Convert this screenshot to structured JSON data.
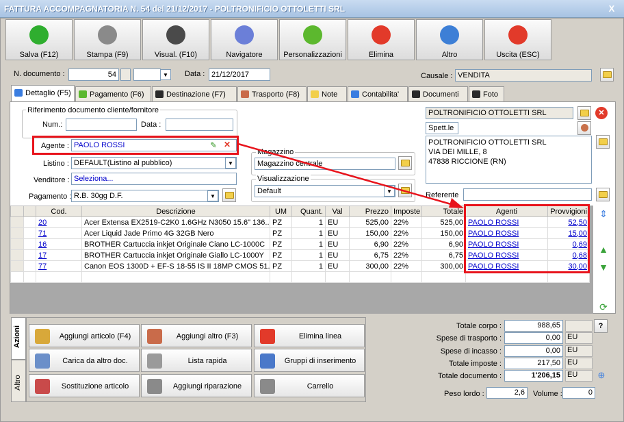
{
  "window": {
    "title": "FATTURA ACCOMPAGNATORIA N. 54 del 21/12/2017 - POLTRONIFICIO OTTOLETTI SRL",
    "close": "X"
  },
  "toolbar": [
    {
      "name": "save",
      "label": "Salva (F12)",
      "icon": "check-icon",
      "color": "#2fae2f"
    },
    {
      "name": "print",
      "label": "Stampa (F9)",
      "icon": "printer-icon",
      "color": "#8a8a8a"
    },
    {
      "name": "preview",
      "label": "Visual. (F10)",
      "icon": "magic-wand-icon",
      "color": "#4a4a4a"
    },
    {
      "name": "navigator",
      "label": "Navigatore",
      "icon": "compass-icon",
      "color": "#6b7fd8"
    },
    {
      "name": "customize",
      "label": "Personalizzazioni",
      "icon": "puzzle-icon",
      "color": "#5cb82e"
    },
    {
      "name": "delete",
      "label": "Elimina",
      "icon": "red-x-icon",
      "color": "#e23a2a"
    },
    {
      "name": "other",
      "label": "Altro",
      "icon": "magnifier-icon",
      "color": "#3d7fd6"
    },
    {
      "name": "exit",
      "label": "Uscita (ESC)",
      "icon": "power-icon",
      "color": "#e23a2a"
    }
  ],
  "header": {
    "doc_label": "N. documento :",
    "doc_number": "54",
    "data_label": "Data :",
    "data_value": "21/12/2017",
    "causale_label": "Causale :",
    "causale_value": "VENDITA"
  },
  "tabs": [
    "Dettaglio (F5)",
    "Pagamento (F6)",
    "Destinazione (F7)",
    "Trasporto (F8)",
    "Note",
    "Contabilita'",
    "Documenti",
    "Foto"
  ],
  "riferimento": {
    "title": "Riferimento documento cliente/fornitore",
    "num_label": "Num.:",
    "data_label": "Data :"
  },
  "fields": {
    "agente_label": "Agente :",
    "agente_value": "PAOLO ROSSI",
    "listino_label": "Listino :",
    "listino_value": "DEFAULT(Listino al pubblico)",
    "venditore_label": "Venditore :",
    "venditore_value": "Seleziona...",
    "pagamento_label": "Pagamento :",
    "pagamento_value": "R.B. 30gg D.F."
  },
  "magazzino": {
    "title": "Magazzino",
    "value": "Magazzino centrale"
  },
  "visualizzazione": {
    "title": "Visualizzazione",
    "value": "Default"
  },
  "customer": {
    "name": "POLTRONIFICIO OTTOLETTI SRL",
    "salutation": "Spett.le",
    "address1": "POLTRONIFICIO OTTOLETTI SRL",
    "address2": "VIA DEI MILLE, 8",
    "address3": "47838 RICCIONE (RN)",
    "referente_label": "Referente"
  },
  "grid": {
    "columns": [
      "Cod.",
      "Descrizione",
      "UM",
      "Quant.",
      "Val",
      "Prezzo",
      "Imposte",
      "Totale",
      "Agenti",
      "Provvigioni"
    ],
    "rows": [
      [
        "20",
        "Acer Extensa EX2519-C2K0 1.6GHz N3050 15.6\" 136...",
        "PZ",
        "1",
        "EU",
        "525,00",
        "22%",
        "525,00",
        "PAOLO ROSSI",
        "52,50"
      ],
      [
        "71",
        "Acer Liquid Jade Primo 4G 32GB Nero",
        "PZ",
        "1",
        "EU",
        "150,00",
        "22%",
        "150,00",
        "PAOLO ROSSI",
        "15,00"
      ],
      [
        "16",
        "BROTHER Cartuccia inkjet Originale Ciano LC-1000C",
        "PZ",
        "1",
        "EU",
        "6,90",
        "22%",
        "6,90",
        "PAOLO ROSSI",
        "0,69"
      ],
      [
        "17",
        "BROTHER Cartuccia inkjet Originale Giallo LC-1000Y",
        "PZ",
        "1",
        "EU",
        "6,75",
        "22%",
        "6,75",
        "PAOLO ROSSI",
        "0,68"
      ],
      [
        "77",
        "Canon EOS 1300D + EF-S 18-55 IS II 18MP CMOS 51...",
        "PZ",
        "1",
        "EU",
        "300,00",
        "22%",
        "300,00",
        "PAOLO ROSSI",
        "30,00"
      ]
    ]
  },
  "side_tabs": {
    "actions": "Azioni",
    "other": "Altro"
  },
  "actions": [
    {
      "name": "aggiungi-articolo",
      "label": "Aggiungi articolo (F4)",
      "icon": "box-add-icon",
      "color": "#d8a83a"
    },
    {
      "name": "aggiungi-altro",
      "label": "Aggiungi altro (F3)",
      "icon": "grid-add-icon",
      "color": "#c96b4a"
    },
    {
      "name": "elimina-linea",
      "label": "Elimina linea",
      "icon": "red-x-icon",
      "color": "#e23a2a"
    },
    {
      "name": "carica-altro-doc",
      "label": "Carica da altro doc.",
      "icon": "checklist-icon",
      "color": "#6b8fc9"
    },
    {
      "name": "lista-rapida",
      "label": "Lista rapida",
      "icon": "list-add-icon",
      "color": "#9a9a9a"
    },
    {
      "name": "gruppi-inserimento",
      "label": "Gruppi di inserimento",
      "icon": "group-add-icon",
      "color": "#4a78c9"
    },
    {
      "name": "sostituzione-articolo",
      "label": "Sostituzione articolo",
      "icon": "shapes-icon",
      "color": "#c94a4a"
    },
    {
      "name": "aggiungi-riparazione",
      "label": "Aggiungi riparazione",
      "icon": "wrench-icon",
      "color": "#8a8a8a"
    },
    {
      "name": "carrello",
      "label": "Carrello",
      "icon": "cart-icon",
      "color": "#8a8a8a"
    }
  ],
  "totals": {
    "corpo_label": "Totale corpo :",
    "corpo_value": "988,65",
    "help": "?",
    "trasporto_label": "Spese di trasporto :",
    "trasporto_value": "0,00",
    "trasporto_cur": "EU",
    "incasso_label": "Spese di incasso :",
    "incasso_value": "0,00",
    "incasso_cur": "EU",
    "imposte_label": "Totale imposte :",
    "imposte_value": "217,50",
    "imposte_cur": "EU",
    "documento_label": "Totale documento :",
    "documento_value": "1'206,15",
    "documento_cur": "EU",
    "peso_label": "Peso lordo :",
    "peso_value": "2,6",
    "volume_label": "Volume :",
    "volume_value": "0"
  },
  "colors": {
    "highlight": "#e8141c",
    "link": "#0000cc"
  }
}
